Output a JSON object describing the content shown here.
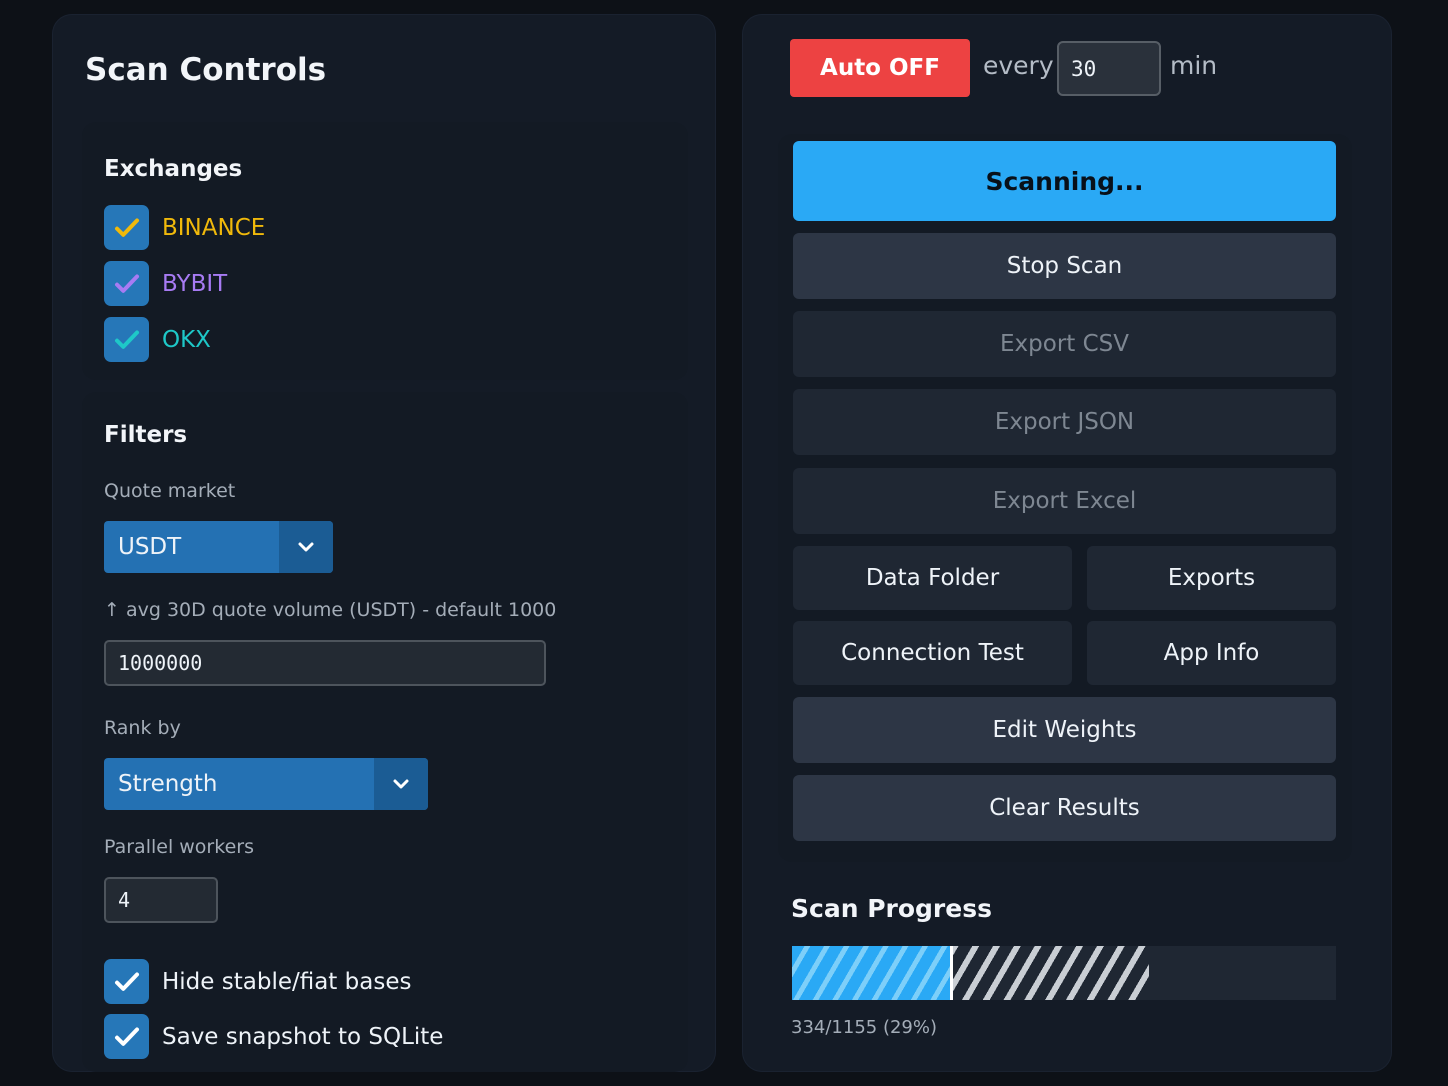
{
  "scan_controls": {
    "title": "Scan Controls",
    "exchanges": {
      "heading": "Exchanges",
      "items": [
        {
          "label": "BINANCE",
          "checked": true,
          "color": "#f0b90b"
        },
        {
          "label": "BYBIT",
          "checked": true,
          "color": "#a77bf3"
        },
        {
          "label": "OKX",
          "checked": true,
          "color": "#1ec8c8"
        }
      ]
    },
    "filters": {
      "heading": "Filters",
      "quote_market_label": "Quote market",
      "quote_market_value": "USDT",
      "volume_label": "↑ avg 30D quote volume (USDT) - default 1000",
      "volume_value": "1000000",
      "rank_by_label": "Rank by",
      "rank_by_value": "Strength",
      "workers_label": "Parallel workers",
      "workers_value": "4",
      "hide_stable_label": "Hide stable/fiat bases",
      "hide_stable_checked": true,
      "save_snapshot_label": "Save snapshot to SQLite",
      "save_snapshot_checked": true
    }
  },
  "auto": {
    "toggle_label": "Auto OFF",
    "every_label": "every",
    "interval_value": "30",
    "unit_label": "min"
  },
  "actions": {
    "scanning": "Scanning...",
    "stop_scan": "Stop Scan",
    "export_csv": "Export CSV",
    "export_json": "Export JSON",
    "export_excel": "Export Excel",
    "data_folder": "Data Folder",
    "exports": "Exports",
    "connection_test": "Connection Test",
    "app_info": "App Info",
    "edit_weights": "Edit Weights",
    "clear_results": "Clear Results"
  },
  "progress": {
    "title": "Scan Progress",
    "completed": 334,
    "total": 1155,
    "fraction": 0.29,
    "text": "334/1155 (29%)"
  }
}
